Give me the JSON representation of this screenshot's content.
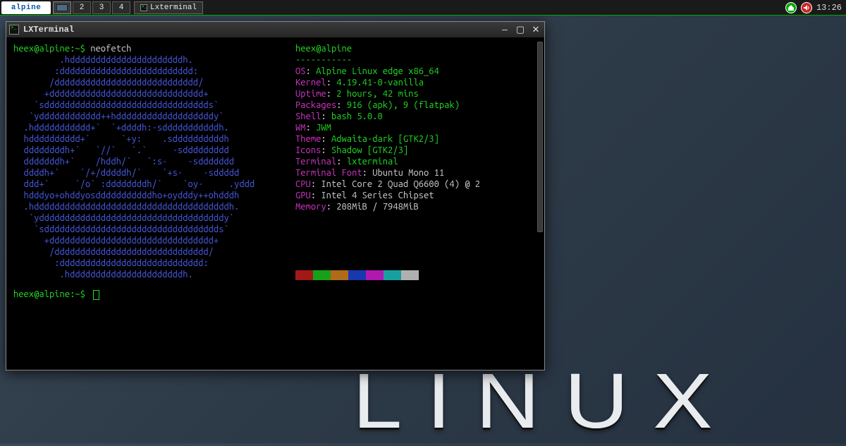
{
  "taskbar": {
    "distro_logo": "alpine",
    "desktops": [
      "",
      "2",
      "3",
      "4"
    ],
    "active_desktop": 0,
    "task_label": "Lxterminal",
    "clock": "13:26",
    "tray_icons": [
      "home-icon",
      "volume-icon"
    ]
  },
  "wallpaper": {
    "logo_text": "LINUX"
  },
  "window": {
    "title": "LXTerminal",
    "btn_min": "—",
    "btn_max": "▢",
    "btn_close": "✕"
  },
  "terminal": {
    "prompt": "heex@alpine:~$",
    "command": "neofetch",
    "prompt2": "heex@alpine:~$",
    "ascii_art": "         .hddddddddddddddddddddddh.\n        :dddddddddddddddddddddddddd:\n       /dddddddddddddddddddddddddddd/\n      +dddddddddddddddddddddddddddddd+\n    `sdddddddddddddddddddddddddddddddds`\n   `ydddddddddddd++hdddddddddddddddddddy`\n  .hddddddddddd+`  `+ddddh:-sdddddddddddh.\n  hdddddddddd+`      `+y:    .sddddddddddh\n  ddddddddh+`   `//`   `.`     -sddddddddd\n  dddddddh+`    /hddh/`   `:s-    -sddddddd\n  ddddh+`    `/+/dddddh/`    `+s-    -sddddd\n  ddd+`     `/o` :ddddddddh/`    `oy-     .yddd\n  hdddyo+ohddyosdddddddddddho+oydddy++ohdddh\n  .hddddddddddddddddddddddddddddddddddddddh.\n   `yddddddddddddddddddddddddddddddddddddy`\n    `sdddddddddddddddddddddddddddddddddds`\n      +dddddddddddddddddddddddddddddddd+\n       /dddddddddddddddddddddddddddddd/\n        :dddddddddddddddddddddddddddd:\n         .hddddddddddddddddddddddh."
  },
  "neofetch": {
    "user_host": "heex@alpine",
    "dashes": "-----------",
    "rows": [
      {
        "key": "OS",
        "val": "Alpine Linux edge x86_64"
      },
      {
        "key": "Kernel",
        "val": "4.19.41-0-vanilla"
      },
      {
        "key": "Uptime",
        "val": "2 hours, 42 mins"
      },
      {
        "key": "Packages",
        "val": "916 (apk), 9 (flatpak)"
      },
      {
        "key": "Shell",
        "val": "bash 5.0.0"
      },
      {
        "key": "WM",
        "val": "JWM"
      },
      {
        "key": "Theme",
        "val": "Adwaita-dark [GTK2/3]"
      },
      {
        "key": "Icons",
        "val": "Shadow [GTK2/3]"
      },
      {
        "key": "Terminal",
        "val": "lxterminal"
      },
      {
        "key": "Terminal Font",
        "val": "Ubuntu Mono 11",
        "white": true
      },
      {
        "key": "CPU",
        "val": "Intel Core 2 Quad Q6600 (4) @ 2",
        "white": true
      },
      {
        "key": "GPU",
        "val": "Intel 4 Series Chipset",
        "white": true
      },
      {
        "key": "Memory",
        "val": "208MiB / 7948MiB",
        "white": true
      }
    ],
    "swatches": [
      "#a01818",
      "#18a018",
      "#b06a18",
      "#1838b0",
      "#b018b0",
      "#18a0a0",
      "#b0b0b0"
    ]
  }
}
